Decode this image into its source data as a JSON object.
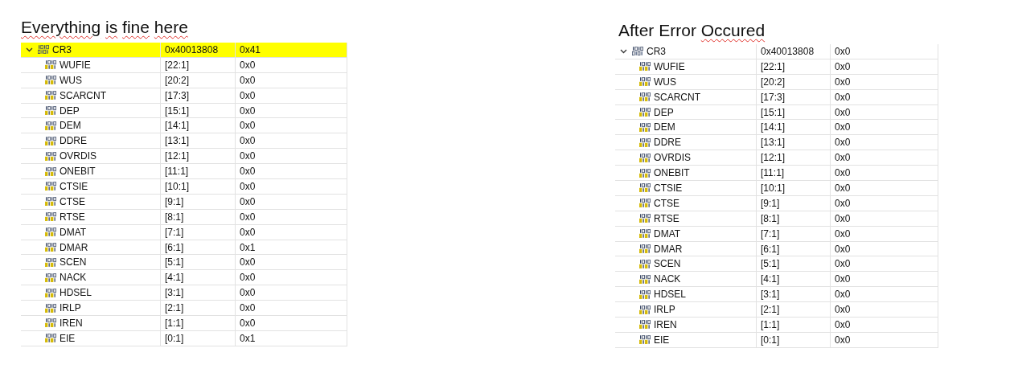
{
  "panels": [
    {
      "title_words": [
        {
          "text": "Everything",
          "flagged": true
        },
        {
          "text": "is",
          "flagged": true
        },
        {
          "text": "fine",
          "flagged": true
        },
        {
          "text": "here",
          "flagged": true
        }
      ],
      "register": {
        "name": "CR3",
        "address": "0x40013808",
        "value": "0x41",
        "expanded": true,
        "highlighted": true
      },
      "fields": [
        {
          "name": "WUFIE",
          "bits": "[22:1]",
          "value": "0x0"
        },
        {
          "name": "WUS",
          "bits": "[20:2]",
          "value": "0x0"
        },
        {
          "name": "SCARCNT",
          "bits": "[17:3]",
          "value": "0x0"
        },
        {
          "name": "DEP",
          "bits": "[15:1]",
          "value": "0x0"
        },
        {
          "name": "DEM",
          "bits": "[14:1]",
          "value": "0x0"
        },
        {
          "name": "DDRE",
          "bits": "[13:1]",
          "value": "0x0"
        },
        {
          "name": "OVRDIS",
          "bits": "[12:1]",
          "value": "0x0"
        },
        {
          "name": "ONEBIT",
          "bits": "[11:1]",
          "value": "0x0"
        },
        {
          "name": "CTSIE",
          "bits": "[10:1]",
          "value": "0x0"
        },
        {
          "name": "CTSE",
          "bits": "[9:1]",
          "value": "0x0"
        },
        {
          "name": "RTSE",
          "bits": "[8:1]",
          "value": "0x0"
        },
        {
          "name": "DMAT",
          "bits": "[7:1]",
          "value": "0x0"
        },
        {
          "name": "DMAR",
          "bits": "[6:1]",
          "value": "0x1"
        },
        {
          "name": "SCEN",
          "bits": "[5:1]",
          "value": "0x0"
        },
        {
          "name": "NACK",
          "bits": "[4:1]",
          "value": "0x0"
        },
        {
          "name": "HDSEL",
          "bits": "[3:1]",
          "value": "0x0"
        },
        {
          "name": "IRLP",
          "bits": "[2:1]",
          "value": "0x0"
        },
        {
          "name": "IREN",
          "bits": "[1:1]",
          "value": "0x0"
        },
        {
          "name": "EIE",
          "bits": "[0:1]",
          "value": "0x1"
        }
      ]
    },
    {
      "title_words": [
        {
          "text": "After",
          "flagged": false
        },
        {
          "text": "Error",
          "flagged": false
        },
        {
          "text": "Occured",
          "flagged": true
        }
      ],
      "register": {
        "name": "CR3",
        "address": "0x40013808",
        "value": "0x0",
        "expanded": true,
        "highlighted": false
      },
      "fields": [
        {
          "name": "WUFIE",
          "bits": "[22:1]",
          "value": "0x0"
        },
        {
          "name": "WUS",
          "bits": "[20:2]",
          "value": "0x0"
        },
        {
          "name": "SCARCNT",
          "bits": "[17:3]",
          "value": "0x0"
        },
        {
          "name": "DEP",
          "bits": "[15:1]",
          "value": "0x0"
        },
        {
          "name": "DEM",
          "bits": "[14:1]",
          "value": "0x0"
        },
        {
          "name": "DDRE",
          "bits": "[13:1]",
          "value": "0x0"
        },
        {
          "name": "OVRDIS",
          "bits": "[12:1]",
          "value": "0x0"
        },
        {
          "name": "ONEBIT",
          "bits": "[11:1]",
          "value": "0x0"
        },
        {
          "name": "CTSIE",
          "bits": "[10:1]",
          "value": "0x0"
        },
        {
          "name": "CTSE",
          "bits": "[9:1]",
          "value": "0x0"
        },
        {
          "name": "RTSE",
          "bits": "[8:1]",
          "value": "0x0"
        },
        {
          "name": "DMAT",
          "bits": "[7:1]",
          "value": "0x0"
        },
        {
          "name": "DMAR",
          "bits": "[6:1]",
          "value": "0x0"
        },
        {
          "name": "SCEN",
          "bits": "[5:1]",
          "value": "0x0"
        },
        {
          "name": "NACK",
          "bits": "[4:1]",
          "value": "0x0"
        },
        {
          "name": "HDSEL",
          "bits": "[3:1]",
          "value": "0x0"
        },
        {
          "name": "IRLP",
          "bits": "[2:1]",
          "value": "0x0"
        },
        {
          "name": "IREN",
          "bits": "[1:1]",
          "value": "0x0"
        },
        {
          "name": "EIE",
          "bits": "[0:1]",
          "value": "0x0"
        }
      ]
    }
  ]
}
